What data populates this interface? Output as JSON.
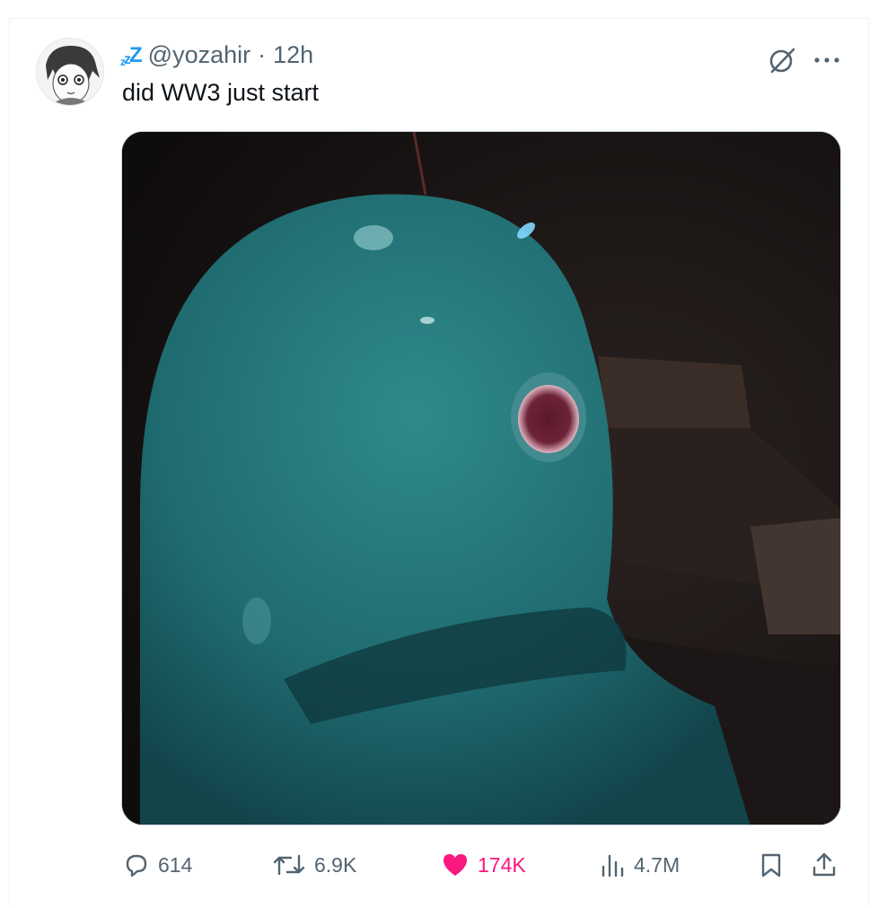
{
  "tweet": {
    "display_name": "ᶻᶻZ",
    "handle": "@yozahir",
    "separator": "·",
    "time": "12h",
    "text": "did WW3 just start"
  },
  "media": {
    "description_icon": "photo-media"
  },
  "actions": {
    "reply_count": "614",
    "retweet_count": "6.9K",
    "like_count": "174K",
    "view_count": "4.7M"
  },
  "colors": {
    "accent": "#1d9bf0",
    "like": "#f91880",
    "muted": "#536471"
  }
}
